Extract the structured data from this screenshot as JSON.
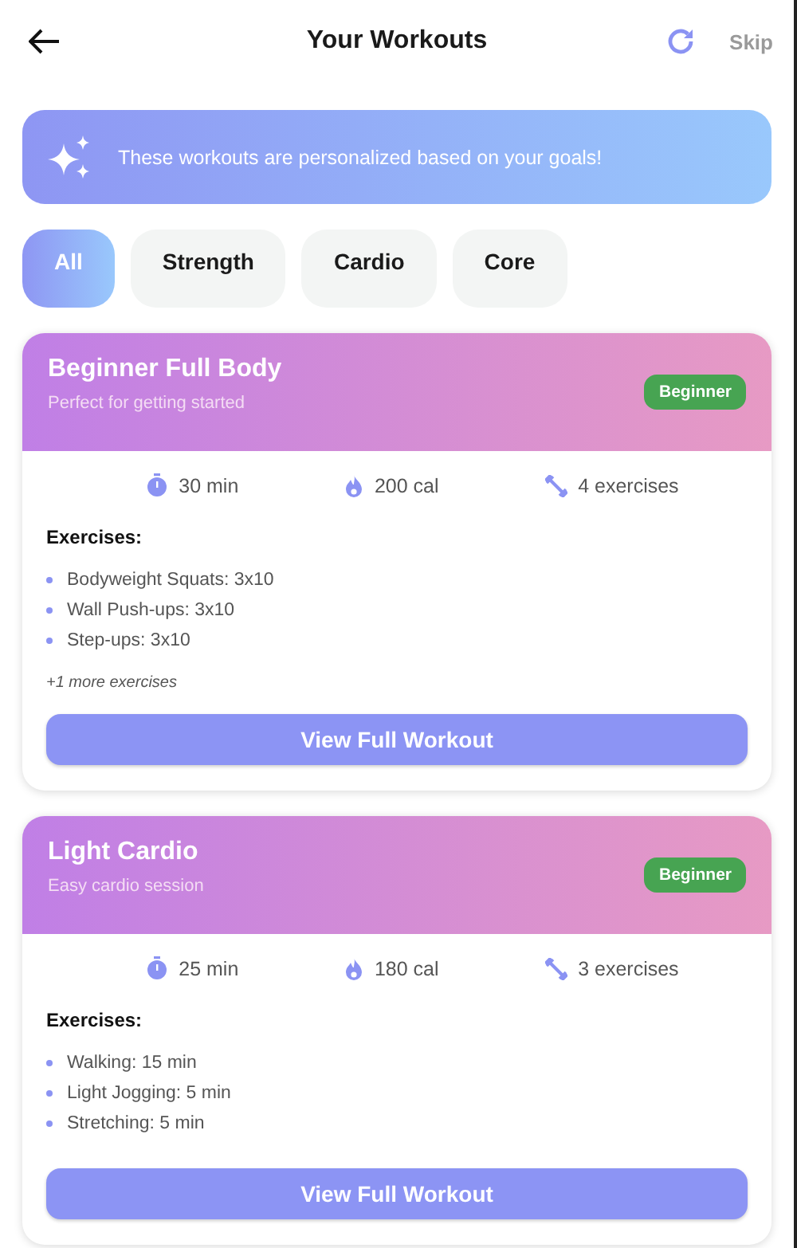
{
  "header": {
    "title": "Your Workouts",
    "skip": "Skip"
  },
  "banner": {
    "text": "These workouts are personalized based on your goals!"
  },
  "filters": [
    {
      "label": "All",
      "selected": true
    },
    {
      "label": "Strength",
      "selected": false
    },
    {
      "label": "Cardio",
      "selected": false
    },
    {
      "label": "Core",
      "selected": false
    }
  ],
  "workouts": [
    {
      "title": "Beginner Full Body",
      "subtitle": "Perfect for getting started",
      "level": "Beginner",
      "duration": "30 min",
      "calories": "200 cal",
      "count": "4 exercises",
      "exercises_label": "Exercises:",
      "exercises": [
        "Bodyweight Squats: 3x10",
        "Wall Push-ups: 3x10",
        "Step-ups: 3x10"
      ],
      "more": "+1 more exercises",
      "button": "View Full Workout"
    },
    {
      "title": "Light Cardio",
      "subtitle": "Easy cardio session",
      "level": "Beginner",
      "duration": "25 min",
      "calories": "180 cal",
      "count": "3 exercises",
      "exercises_label": "Exercises:",
      "exercises": [
        "Walking: 15 min",
        "Light Jogging: 5 min",
        "Stretching: 5 min"
      ],
      "button": "View Full Workout"
    }
  ]
}
